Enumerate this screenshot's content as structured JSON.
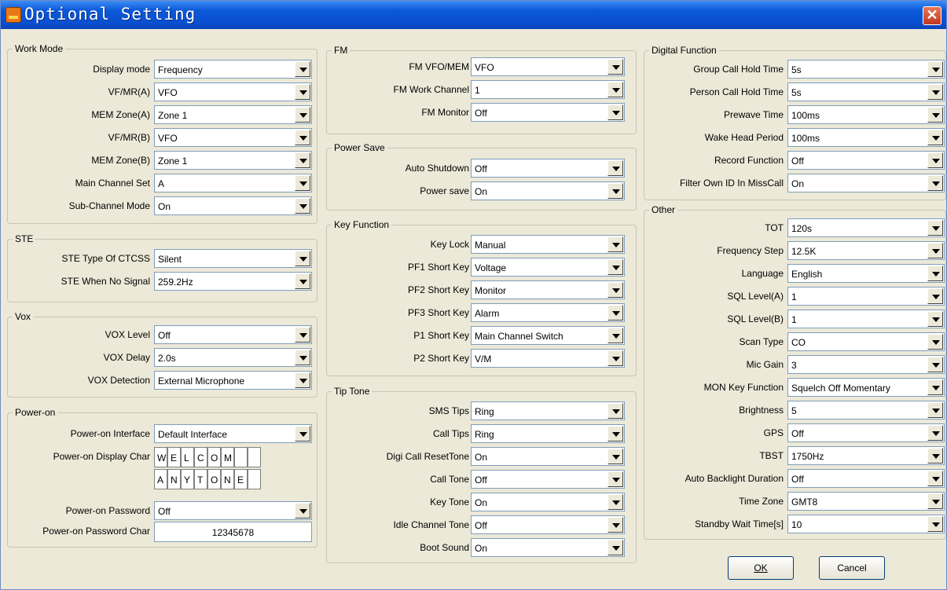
{
  "window": {
    "title": "Optional Setting",
    "close_glyph": "✕"
  },
  "groups": {
    "work_mode": {
      "title": "Work Mode",
      "rows": [
        {
          "label": "Display mode",
          "value": "Frequency"
        },
        {
          "label": "VF/MR(A)",
          "value": "VFO"
        },
        {
          "label": "MEM Zone(A)",
          "value": "Zone 1"
        },
        {
          "label": "VF/MR(B)",
          "value": "VFO"
        },
        {
          "label": "MEM Zone(B)",
          "value": "Zone 1"
        },
        {
          "label": "Main Channel Set",
          "value": "A"
        },
        {
          "label": "Sub-Channel Mode",
          "value": "On"
        }
      ]
    },
    "ste": {
      "title": "STE",
      "rows": [
        {
          "label": "STE Type Of CTCSS",
          "value": "Silent"
        },
        {
          "label": "STE When No Signal",
          "value": "259.2Hz"
        }
      ]
    },
    "vox": {
      "title": "Vox",
      "rows": [
        {
          "label": "VOX Level",
          "value": "Off"
        },
        {
          "label": "VOX Delay",
          "value": "2.0s"
        },
        {
          "label": "VOX Detection",
          "value": "External Microphone"
        }
      ]
    },
    "power_on": {
      "title": "Power-on",
      "interface_label": "Power-on Interface",
      "interface_value": "Default Interface",
      "display_char_label": "Power-on Display Char",
      "chars_row1": [
        "W",
        "E",
        "L",
        "C",
        "O",
        "M",
        "",
        ""
      ],
      "chars_row2": [
        "A",
        "N",
        "Y",
        "T",
        "O",
        "N",
        "E",
        ""
      ],
      "password_label": "Power-on Password",
      "password_value": "Off",
      "password_char_label": "Power-on Password Char",
      "password_char_value": "12345678"
    },
    "fm": {
      "title": "FM",
      "rows": [
        {
          "label": "FM VFO/MEM",
          "value": "VFO"
        },
        {
          "label": "FM Work Channel",
          "value": "1"
        },
        {
          "label": "FM Monitor",
          "value": "Off"
        }
      ]
    },
    "power_save": {
      "title": "Power Save",
      "rows": [
        {
          "label": "Auto Shutdown",
          "value": "Off"
        },
        {
          "label": "Power save",
          "value": "On"
        }
      ]
    },
    "key_function": {
      "title": "Key Function",
      "rows": [
        {
          "label": "Key Lock",
          "value": "Manual"
        },
        {
          "label": "PF1 Short Key",
          "value": "Voltage"
        },
        {
          "label": "PF2 Short Key",
          "value": "Monitor"
        },
        {
          "label": "PF3 Short Key",
          "value": "Alarm"
        },
        {
          "label": "P1 Short Key",
          "value": "Main Channel Switch"
        },
        {
          "label": "P2 Short Key",
          "value": "V/M"
        }
      ]
    },
    "tip_tone": {
      "title": "Tip Tone",
      "rows": [
        {
          "label": "SMS Tips",
          "value": "Ring"
        },
        {
          "label": "Call Tips",
          "value": "Ring"
        },
        {
          "label": "Digi Call ResetTone",
          "value": "On"
        },
        {
          "label": "Call Tone",
          "value": "Off"
        },
        {
          "label": "Key Tone",
          "value": "On"
        },
        {
          "label": "Idle Channel Tone",
          "value": "Off"
        },
        {
          "label": "Boot Sound",
          "value": "On"
        }
      ]
    },
    "digital_function": {
      "title": "Digital Function",
      "rows": [
        {
          "label": "Group Call Hold Time",
          "value": "5s"
        },
        {
          "label": "Person Call Hold Time",
          "value": "5s"
        },
        {
          "label": "Prewave Time",
          "value": "100ms"
        },
        {
          "label": "Wake Head Period",
          "value": "100ms"
        },
        {
          "label": "Record Function",
          "value": "Off"
        },
        {
          "label": "Filter Own ID In MissCall",
          "value": "On"
        }
      ]
    },
    "other": {
      "title": "Other",
      "rows": [
        {
          "label": "TOT",
          "value": "120s"
        },
        {
          "label": "Frequency Step",
          "value": "12.5K"
        },
        {
          "label": "Language",
          "value": "English"
        },
        {
          "label": "SQL Level(A)",
          "value": "1"
        },
        {
          "label": "SQL Level(B)",
          "value": "1"
        },
        {
          "label": "Scan Type",
          "value": "CO"
        },
        {
          "label": "Mic Gain",
          "value": "3"
        },
        {
          "label": "MON Key Function",
          "value": "Squelch Off Momentary"
        },
        {
          "label": "Brightness",
          "value": "5"
        },
        {
          "label": "GPS",
          "value": "Off"
        },
        {
          "label": "TBST",
          "value": "1750Hz"
        },
        {
          "label": "Auto Backlight Duration",
          "value": "Off"
        },
        {
          "label": "Time Zone",
          "value": "GMT8"
        },
        {
          "label": "Standby Wait Time[s]",
          "value": "10"
        }
      ]
    }
  },
  "buttons": {
    "ok": "OK",
    "cancel": "Cancel"
  },
  "icons": {
    "app": "app-icon",
    "close": "close-icon",
    "dropdown": "chevron-down-icon"
  },
  "colors": {
    "titlebar": "#0a58d8",
    "dialog_bg": "#ece9d8",
    "close": "#c0361e"
  }
}
